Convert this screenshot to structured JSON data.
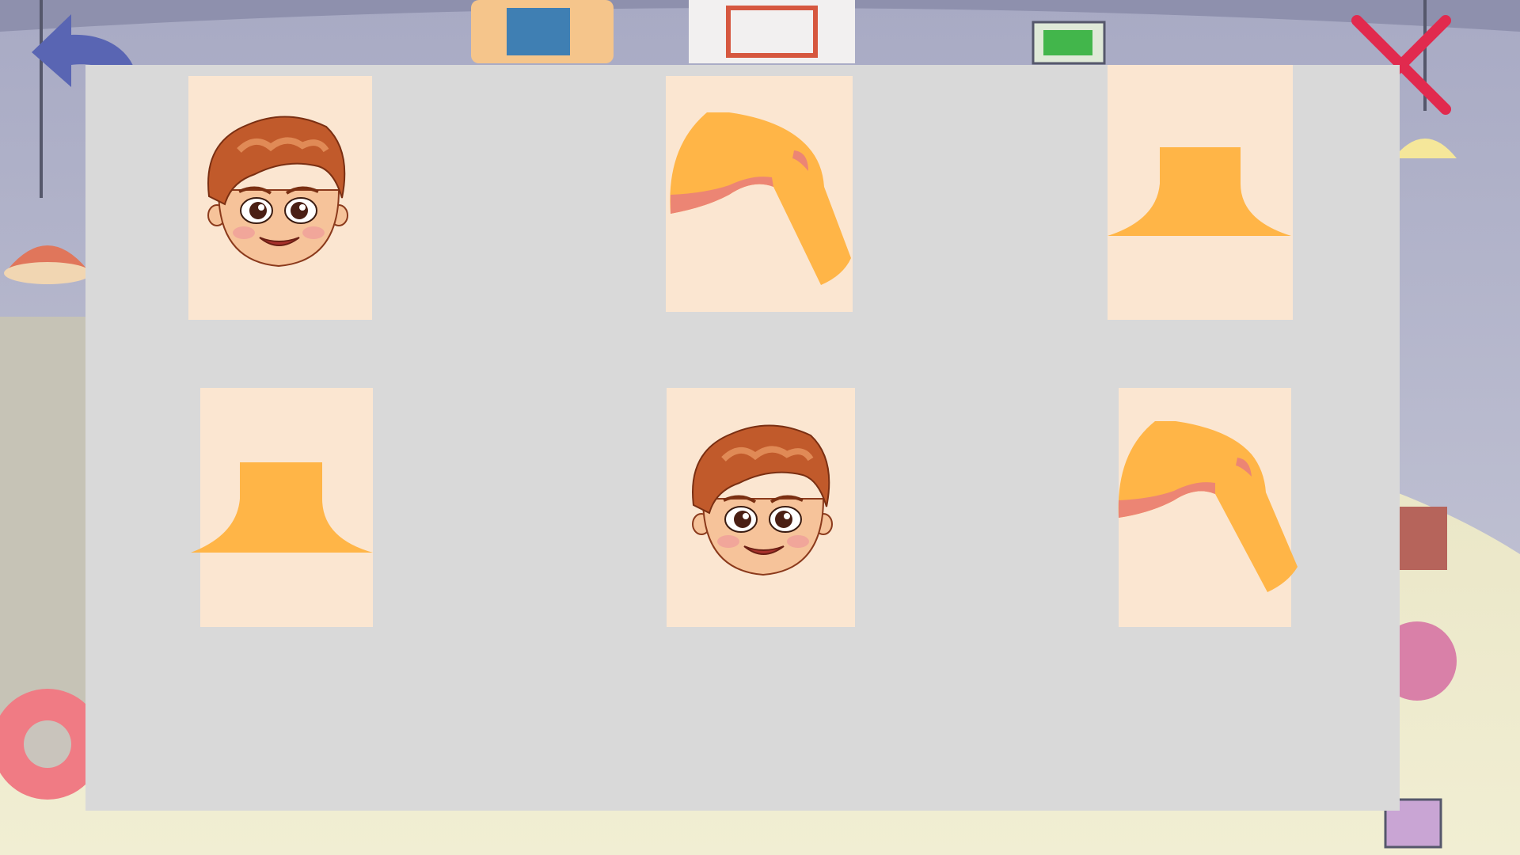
{
  "game": {
    "screen": "memory-match",
    "theme": {
      "panel_color": "#d9d9d9",
      "card_color": "#fbe6d1",
      "piece_color": "#ffb547",
      "piece_accent": "#ec8574",
      "back_arrow_color": "#5965b3",
      "close_color": "#e12a4e"
    }
  },
  "toolbar": {
    "back_icon": "curved-back-arrow-icon",
    "close_icon": "close-x-icon"
  },
  "cards": [
    {
      "id": 1,
      "content": "boy-face",
      "icon": "boy-face-icon",
      "state": "face-up"
    },
    {
      "id": 2,
      "content": "arm",
      "icon": "arm-icon",
      "state": "face-up"
    },
    {
      "id": 3,
      "content": "torso",
      "icon": "torso-icon",
      "state": "face-up"
    },
    {
      "id": 4,
      "content": "torso",
      "icon": "torso-icon",
      "state": "face-up"
    },
    {
      "id": 5,
      "content": "boy-face",
      "icon": "boy-face-icon",
      "state": "face-up"
    },
    {
      "id": 6,
      "content": "arm",
      "icon": "arm-icon",
      "state": "face-up"
    }
  ]
}
